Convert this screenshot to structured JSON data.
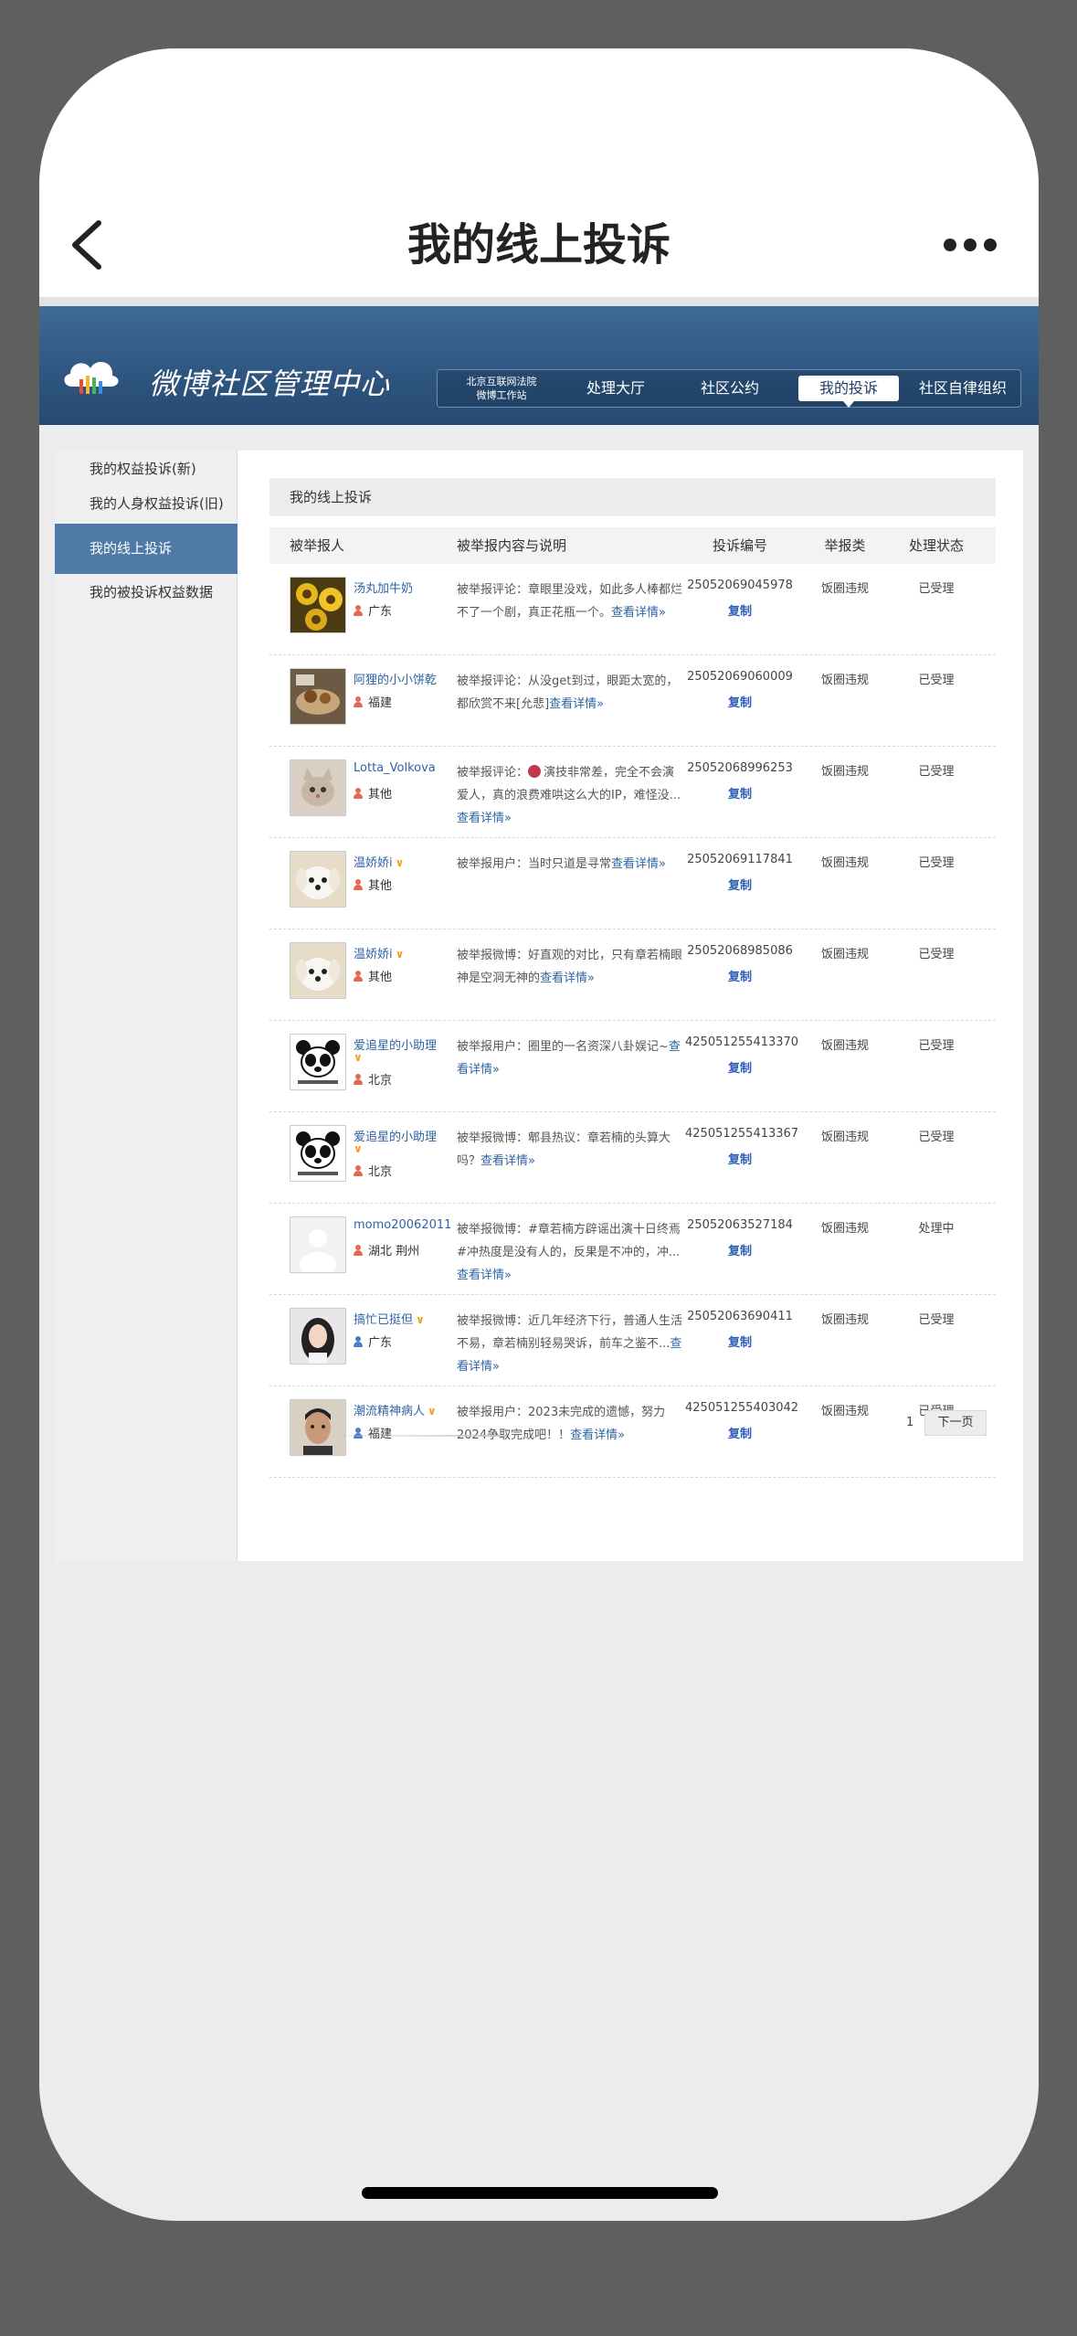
{
  "app": {
    "title": "我的线上投诉"
  },
  "site": {
    "logo_text": "微博社区管理中心",
    "nav": [
      {
        "label": "北京互联网法院\n微博工作站"
      },
      {
        "label": "处理大厅"
      },
      {
        "label": "社区公约"
      },
      {
        "label": "我的投诉",
        "active": true
      },
      {
        "label": "社区自律组织"
      }
    ]
  },
  "sidebar": {
    "items": [
      {
        "label": "我的权益投诉(新)"
      },
      {
        "label": "我的人身权益投诉(旧)"
      },
      {
        "label": "我的线上投诉",
        "active": true
      },
      {
        "label": "我的被投诉权益数据"
      }
    ]
  },
  "main": {
    "section_title": "我的线上投诉",
    "columns": [
      "被举报人",
      "被举报内容与说明",
      "投诉编号",
      "举报类",
      "处理状态"
    ],
    "copy_label": "复制",
    "detail_label": "查看详情»",
    "rows": [
      {
        "name": "汤丸加牛奶",
        "verified": false,
        "gender": "female",
        "location": "广东",
        "desc": "被举报评论：章眼里没戏，如此多人棒都烂不了一个剧，真正花瓶一个。",
        "detail_line": "查看详",
        "detail_tail": "情»",
        "code": "25052069045978",
        "category": "饭圈违规",
        "status": "已受理",
        "avatar": "sunflower"
      },
      {
        "name": "阿狸的小小饼乾",
        "verified": false,
        "gender": "female",
        "location": "福建",
        "desc": "被举报评论：从没get到过，眼距太宽的，都欣赏不来[允悲]",
        "detail": "查看详情»",
        "code": "25052069060009",
        "category": "饭圈违规",
        "status": "已受理",
        "avatar": "food"
      },
      {
        "name": "Lotta_Volkova",
        "verified": false,
        "gender": "female",
        "location": "其他",
        "desc_pre": "被举报评论：",
        "desc": "演技非常差，完全不会演爱人，真的浪费难哄这么大的IP，难怪没...",
        "detail": "查看详情»",
        "code": "25052068996253",
        "category": "饭圈违规",
        "status": "已受理",
        "avatar": "cat"
      },
      {
        "name": "温娇娇i",
        "verified": true,
        "gender": "female",
        "location": "其他",
        "desc": "被举报用户：当时只道是寻常",
        "detail": "查看详情»",
        "code": "25052069117841",
        "category": "饭圈违规",
        "status": "已受理",
        "avatar": "dog"
      },
      {
        "name": "温娇娇i",
        "verified": true,
        "gender": "female",
        "location": "其他",
        "desc": "被举报微博：好直观的对比，只有章若楠眼神是空洞无神的",
        "detail": "查看详情»",
        "code": "25052068985086",
        "category": "饭圈违规",
        "status": "已受理",
        "avatar": "dog"
      },
      {
        "name": "爱追星的小助理",
        "verified": true,
        "gender": "female",
        "location": "北京",
        "desc": "被举报用户：圈里的一名资深八卦娱记~",
        "detail": "查看详情»",
        "code": "425051255413370",
        "category": "饭圈违规",
        "status": "已受理",
        "avatar": "panda"
      },
      {
        "name": "爱追星的小助理",
        "verified": true,
        "gender": "female",
        "location": "北京",
        "desc": "被举报微博：郫县热议：章若楠的头算大吗？",
        "detail": "查看详情»",
        "code": "425051255413367",
        "category": "饭圈违规",
        "status": "已受理",
        "avatar": "panda"
      },
      {
        "name": "momo20062011",
        "verified": false,
        "gender": "female",
        "location": "湖北 荆州",
        "desc": "被举报微博：#章若楠方辟谣出演十日终焉#冲热度是没有人的，反果是不冲的，冲...",
        "detail": "查看详情»",
        "code": "25052063527184",
        "category": "饭圈违规",
        "status": "处理中",
        "avatar": "blank"
      },
      {
        "name": "搞忙已挺但",
        "verified": true,
        "gender": "male",
        "location": "广东",
        "desc": "被举报微博：近几年经济下行，普通人生活不易，章若楠别轻易哭诉，前车之鉴不...",
        "detail": "查看详情»",
        "code": "25052063690411",
        "category": "饭圈违规",
        "status": "已受理",
        "avatar": "girl"
      },
      {
        "name": "潮流精神病人",
        "verified": true,
        "gender": "male",
        "location": "福建",
        "desc": "被举报用户：2023未完成的遗憾，努力2024争取完成吧！！",
        "detail": "查看详情»",
        "code": "425051255403042",
        "category": "饭圈违规",
        "status": "已受理",
        "avatar": "boy"
      }
    ]
  },
  "pager": {
    "page": "1",
    "next_label": "下一页"
  },
  "colors": {
    "header_blue": "#2e557f",
    "sidebar_active": "#4f7aa8",
    "link_blue": "#2f63a3",
    "verified_orange": "#f0a020"
  }
}
